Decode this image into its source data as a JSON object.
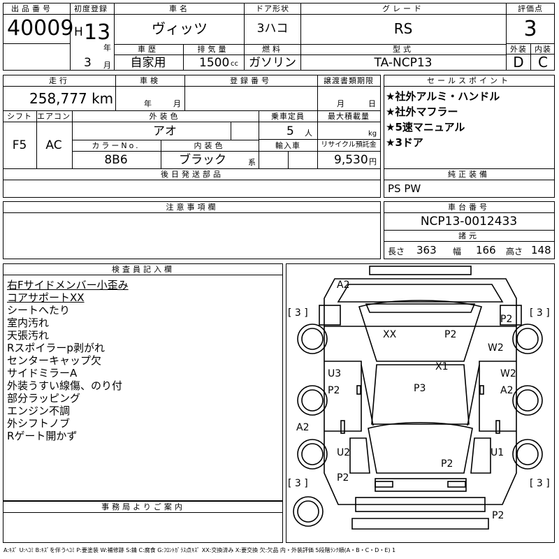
{
  "header": {
    "lot_label": "出品番号",
    "lot_no": "40009",
    "first_reg_label": "初度登録",
    "era": "H",
    "year": "13",
    "year_unit": "年",
    "month": "3",
    "month_unit": "月",
    "name_label": "車名",
    "name": "ヴィッツ",
    "door_label": "ドア形状",
    "door": "3ハコ",
    "grade_label": "グレード",
    "grade": "RS",
    "score_label": "評価点",
    "score": "3",
    "ext_label": "外装",
    "ext": "D",
    "int_label": "内装",
    "int": "C",
    "history_label": "車歴",
    "history": "自家用",
    "disp_label": "排気量",
    "disp": "1500",
    "disp_unit": "cc",
    "fuel_label": "燃料",
    "fuel": "ガソリン",
    "model_label": "型式",
    "model": "TA-NCP13"
  },
  "row2": {
    "mileage_label": "走行",
    "mileage": "258,777 km",
    "inspection_label": "車検",
    "insp_year_unit": "年",
    "insp_month_unit": "月",
    "reg_label": "登録番号",
    "transfer_label": "譲渡書類期限",
    "transfer_month_unit": "月",
    "transfer_day_unit": "日",
    "shift_label": "シフト",
    "shift": "F5",
    "ac_label": "エアコン",
    "ac": "AC",
    "color_label": "外装色",
    "color": "アオ",
    "capacity_label": "乗車定員",
    "capacity": "5",
    "capacity_unit": "人",
    "load_label": "最大積載量",
    "load_unit": "kg",
    "color_no_label": "カラーNo.",
    "color_no": "8B6",
    "int_color_label": "内装色",
    "int_color": "ブラック",
    "int_color_unit": "系",
    "import_label": "輸入車",
    "recycle_label": "リサイクル預託金",
    "recycle": "9,530",
    "recycle_unit": "円",
    "later_parts_label": "後日発送部品"
  },
  "sales": {
    "label": "セールスポイント",
    "items": [
      "★社外アルミ・ハンドル",
      "★社外マフラー",
      "★5速マニュアル",
      "★3ドア"
    ]
  },
  "equipment": {
    "label": "純正装備",
    "value": "PS PW"
  },
  "notes": {
    "label": "注意事項欄"
  },
  "chassis": {
    "label": "車台番号",
    "value": "NCP13-0012433",
    "dims_label": "諸元",
    "length_label": "長さ",
    "length": "363",
    "width_label": "幅",
    "width": "166",
    "height_label": "高さ",
    "height": "148"
  },
  "inspector": {
    "label": "検査員記入欄",
    "lines": [
      "右Fサイドメンバー小歪み",
      "コアサポートXX",
      "シートへたり",
      "室内汚れ",
      "天張汚れ",
      "Rスポイラーp剥がれ",
      "センターキャップ欠",
      "サイドミラーA",
      "外装うすい線傷、のり付",
      "部分ラッピング",
      "エンジン不調",
      "外シフトノブ",
      "Rゲート開かず"
    ]
  },
  "office": {
    "label": "事務局よりご案内"
  },
  "diagram": {
    "tire_marks": [
      "[ 3 ]",
      "[ 3 ]",
      "[ 3 ]",
      "[ 3 ]"
    ],
    "marks": [
      "A2",
      "P2",
      "XX",
      "P2",
      "W2",
      "X1",
      "U3",
      "W2",
      "P2",
      "P3",
      "A2",
      "A2",
      "U2",
      "U1",
      "P2",
      "P2",
      "P2"
    ]
  },
  "footer": "A:ｷｽﾞ U:ﾍｺﾐ B:ｷｽﾞを伴うﾍｺﾐ P:要塗装 W:補修跡 S:錆 C:腐食 G:ﾌﾛﾝﾄｶﾞﾗｽ点ｷｽﾞ XX:交換済み X:要交換 欠:欠品 内・外装評価 5段階ﾗﾝｸ順(A・B・C・D・E) 1"
}
